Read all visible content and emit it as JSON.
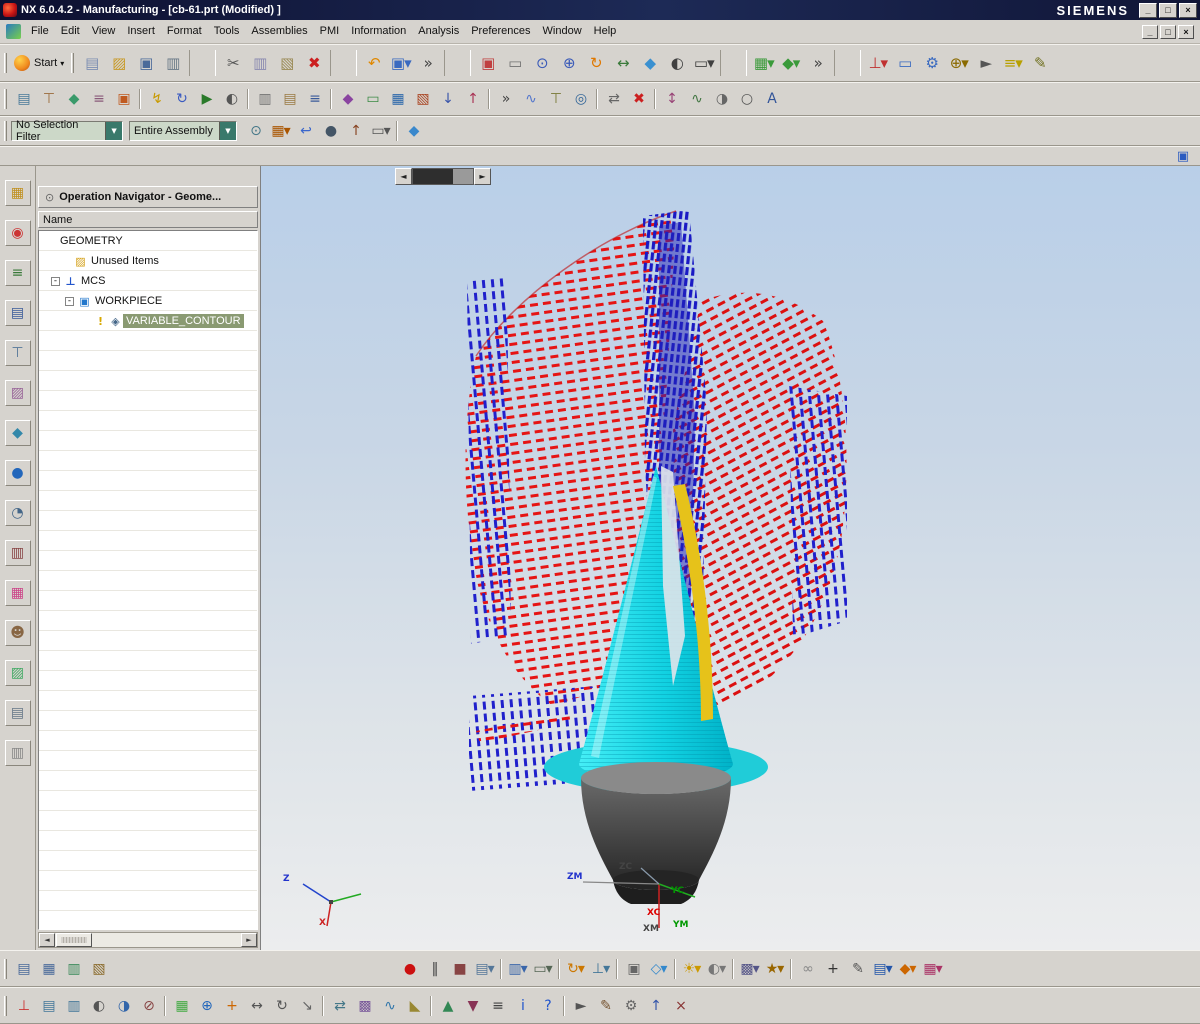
{
  "window": {
    "title": "NX 6.0.4.2 - Manufacturing - [cb-61.prt (Modified) ]",
    "brand": "SIEMENS"
  },
  "glyphs": {
    "minimize": "_",
    "restore": "□",
    "close": "×",
    "scroll_left": "◄",
    "scroll_right": "►",
    "dropdown": "▼",
    "thin_dropdown": "▾",
    "pin": "⊙"
  },
  "menus": [
    "File",
    "Edit",
    "View",
    "Insert",
    "Format",
    "Tools",
    "Assemblies",
    "PMI",
    "Information",
    "Analysis",
    "Preferences",
    "Window",
    "Help"
  ],
  "toolbar_main": {
    "start_label": "Start",
    "items": [
      {
        "n": "new-file-icon",
        "g": "▤",
        "c": "#7d8fb3"
      },
      {
        "n": "open-file-icon",
        "g": "▨",
        "c": "#c89a28"
      },
      {
        "n": "save-icon",
        "g": "▣",
        "c": "#4a6a9a"
      },
      {
        "n": "print-icon",
        "g": "▥",
        "c": "#6a7a88"
      },
      {
        "n": "separator",
        "g": ""
      },
      {
        "n": "cut-icon",
        "g": "✂",
        "c": "#555555"
      },
      {
        "n": "copy-icon",
        "g": "▥",
        "c": "#8a8ab0"
      },
      {
        "n": "paste-icon",
        "g": "▧",
        "c": "#9a8a55"
      },
      {
        "n": "delete-icon",
        "g": "✖",
        "c": "#cc2020"
      },
      {
        "n": "separator",
        "g": ""
      },
      {
        "n": "undo-icon",
        "g": "↶",
        "c": "#e08800"
      },
      {
        "n": "selection-dialog-icon",
        "g": "▣▾",
        "c": "#3a6ac0"
      },
      {
        "n": "overflow-icon",
        "g": "»",
        "c": "#444444"
      },
      {
        "n": "separator",
        "g": ""
      },
      {
        "n": "fit-view-icon",
        "g": "▣",
        "c": "#c04040"
      },
      {
        "n": "zoom-box-icon",
        "g": "▭",
        "c": "#707070"
      },
      {
        "n": "zoom-icon",
        "g": "⊙",
        "c": "#3a5ab8"
      },
      {
        "n": "zoom-in-out-icon",
        "g": "⊕",
        "c": "#3a5ab8"
      },
      {
        "n": "rotate-view-icon",
        "g": "↻",
        "c": "#e07800"
      },
      {
        "n": "pan-icon",
        "g": "↔",
        "c": "#3a7a3a"
      },
      {
        "n": "perspective-icon",
        "g": "◆",
        "c": "#3a90d0"
      },
      {
        "n": "shaded-view-icon",
        "g": "◐",
        "c": "#404040"
      },
      {
        "n": "face-style-icon",
        "g": "▭▾",
        "c": "#404040"
      },
      {
        "n": "separator",
        "g": ""
      },
      {
        "n": "orient-view-icon",
        "g": "▦▾",
        "c": "#3a9a3a"
      },
      {
        "n": "iso-view-icon",
        "g": "◆▾",
        "c": "#3a9a3a"
      },
      {
        "n": "overflow-icon",
        "g": "»",
        "c": "#444444"
      },
      {
        "n": "separator",
        "g": ""
      },
      {
        "n": "csys-icon",
        "g": "⊥▾",
        "c": "#c03030"
      },
      {
        "n": "datum-plane-icon",
        "g": "▭",
        "c": "#3a6ac0"
      },
      {
        "n": "gear-icon",
        "g": "⚙",
        "c": "#3a6ac0"
      },
      {
        "n": "point-icon",
        "g": "⊕▾",
        "c": "#8a6a00"
      },
      {
        "n": "cursor-icon",
        "g": "►",
        "c": "#555555"
      },
      {
        "n": "measure-icon",
        "g": "≡▾",
        "c": "#b8a000"
      },
      {
        "n": "sketch-icon",
        "g": "✎",
        "c": "#707020"
      }
    ]
  },
  "toolbar_mfg": {
    "items": [
      {
        "n": "create-program-icon",
        "g": "▤",
        "c": "#4a7a9a"
      },
      {
        "n": "create-tool-icon",
        "g": "⊤",
        "c": "#9a6a3a"
      },
      {
        "n": "create-geometry-icon",
        "g": "◆",
        "c": "#3a9a6a"
      },
      {
        "n": "create-method-icon",
        "g": "≡",
        "c": "#8a5a7a"
      },
      {
        "n": "create-operation-icon",
        "g": "▣",
        "c": "#c05a20"
      },
      {
        "n": "separator",
        "g": ""
      },
      {
        "n": "generate-toolpath-icon",
        "g": "↯",
        "c": "#c89a00"
      },
      {
        "n": "replay-toolpath-icon",
        "g": "↻",
        "c": "#3a5ac0"
      },
      {
        "n": "verify-toolpath-icon",
        "g": "▶",
        "c": "#2a7a2a"
      },
      {
        "n": "simulate-icon",
        "g": "◐",
        "c": "#555555"
      },
      {
        "n": "separator",
        "g": ""
      },
      {
        "n": "postprocess-icon",
        "g": "▥",
        "c": "#707070"
      },
      {
        "n": "shop-doc-icon",
        "g": "▤",
        "c": "#9a7a44"
      },
      {
        "n": "list-toolpath-icon",
        "g": "≡",
        "c": "#3a5a9a"
      },
      {
        "n": "separator",
        "g": ""
      },
      {
        "n": "machining-environment-icon",
        "g": "◆",
        "c": "#8a44a0"
      },
      {
        "n": "boundary-icon",
        "g": "▭",
        "c": "#3a8a44"
      },
      {
        "n": "mill-area-icon",
        "g": "▦",
        "c": "#2a66aa"
      },
      {
        "n": "drive-method-icon",
        "g": "▧",
        "c": "#aa4422"
      },
      {
        "n": "projection-vector-icon",
        "g": "↓",
        "c": "#3a55aa"
      },
      {
        "n": "tool-axis-icon",
        "g": "↑",
        "c": "#aa3355"
      },
      {
        "n": "separator",
        "g": ""
      },
      {
        "n": "overflow-icon",
        "g": "»",
        "c": "#444444"
      },
      {
        "n": "graph-icon",
        "g": "∿",
        "c": "#5577cc"
      },
      {
        "n": "tool-display-icon",
        "g": "⊤",
        "c": "#777733"
      },
      {
        "n": "feeds-speeds-icon",
        "g": "◎",
        "c": "#336699"
      },
      {
        "n": "separator",
        "g": ""
      },
      {
        "n": "transform-icon",
        "g": "⇄",
        "c": "#666666"
      },
      {
        "n": "delete-operation-icon",
        "g": "✖",
        "c": "#cc2020"
      },
      {
        "n": "separator",
        "g": ""
      },
      {
        "n": "tilt-tool-axis-icon",
        "g": "↕",
        "c": "#994477"
      },
      {
        "n": "smoothing-icon",
        "g": "∿",
        "c": "#447744"
      },
      {
        "n": "balance-icon",
        "g": "◑",
        "c": "#666666"
      },
      {
        "n": "arc-output-icon",
        "g": "○",
        "c": "#555555"
      },
      {
        "n": "annotation-icon",
        "g": "A",
        "c": "#335599"
      }
    ]
  },
  "filterbar": {
    "selection_filter": "No Selection Filter",
    "scope": "Entire Assembly",
    "items": [
      {
        "n": "snap-point-icon",
        "g": "⊙",
        "c": "#447788"
      },
      {
        "n": "selection-grid-icon",
        "g": "▦▾",
        "c": "#aa5500"
      },
      {
        "n": "back-icon",
        "g": "↩",
        "c": "#3a66cc"
      },
      {
        "n": "sphere-display-icon",
        "g": "●",
        "c": "#445566"
      },
      {
        "n": "elevate-icon",
        "g": "↑",
        "c": "#884422"
      },
      {
        "n": "marquee-select-icon",
        "g": "▭▾",
        "c": "#555555"
      },
      {
        "n": "separator",
        "g": ""
      },
      {
        "n": "assembly-cube-icon",
        "g": "◆",
        "c": "#3a88cc"
      }
    ]
  },
  "resource_bar": {
    "items": [
      {
        "n": "assembly-navigator-icon",
        "g": "▦",
        "c": "#c09020"
      },
      {
        "n": "constraint-navigator-icon",
        "g": "◉",
        "c": "#cc3333"
      },
      {
        "n": "part-navigator-icon",
        "g": "≡",
        "c": "#3a7a3a"
      },
      {
        "n": "operation-navigator-icon",
        "g": "▤",
        "c": "#3a5a9a"
      },
      {
        "n": "machine-tool-navigator-icon",
        "g": "⊤",
        "c": "#557799"
      },
      {
        "n": "reuse-library-icon",
        "g": "▨",
        "c": "#996699"
      },
      {
        "n": "hd3d-tools-icon",
        "g": "◆",
        "c": "#3388aa"
      },
      {
        "n": "web-browser-icon",
        "g": "●",
        "c": "#2266bb"
      },
      {
        "n": "history-icon",
        "g": "◔",
        "c": "#446688"
      },
      {
        "n": "process-studio-icon",
        "g": "▥",
        "c": "#884444"
      },
      {
        "n": "manufacturing-wizards-icon",
        "g": "▦",
        "c": "#cc4488"
      },
      {
        "n": "roles-icon",
        "g": "☻",
        "c": "#886644"
      },
      {
        "n": "system-scenes-icon",
        "g": "▨",
        "c": "#44aa66"
      },
      {
        "n": "documents-icon",
        "g": "▤",
        "c": "#667788"
      },
      {
        "n": "notes-icon",
        "g": "▥",
        "c": "#888888"
      }
    ]
  },
  "navigator": {
    "title": "Operation Navigator - Geome...",
    "column_header": "Name",
    "rows": [
      {
        "pad": "6px",
        "ex": "",
        "i1": "",
        "i1c": "",
        "i2": "",
        "i2c": "",
        "label": "GEOMETRY",
        "bg": "",
        "fg": ""
      },
      {
        "pad": "22px",
        "ex": "",
        "i1": "▨",
        "i1c": "#d4a017",
        "i2": "",
        "i2c": "",
        "label": "Unused Items",
        "bg": "",
        "fg": ""
      },
      {
        "pad": "12px",
        "ex": "-",
        "i1": "⊥",
        "i1c": "#2255cc",
        "i2": "",
        "i2c": "",
        "label": "MCS",
        "bg": "",
        "fg": ""
      },
      {
        "pad": "26px",
        "ex": "-",
        "i1": "▣",
        "i1c": "#2277cc",
        "i2": "",
        "i2c": "",
        "label": "WORKPIECE",
        "bg": "",
        "fg": ""
      },
      {
        "pad": "42px",
        "ex": "",
        "i1": "!",
        "i1c": "#d8a800",
        "i2": "◈",
        "i2c": "#446688",
        "label": "VARIABLE_CONTOUR",
        "bg": "#8a9a72",
        "fg": "#ffffff"
      }
    ]
  },
  "viewport": {
    "triad": {
      "z": "Z",
      "x": "X"
    },
    "mcs_labels": {
      "zm": "ZM",
      "zc": "ZC",
      "yc": "YC",
      "xc": "XC",
      "xm": "XM",
      "ym": "YM"
    }
  },
  "bottom1": {
    "items": [
      {
        "n": "view-tool-1-icon",
        "g": "▤",
        "c": "#4a6a9a"
      },
      {
        "n": "view-tool-2-icon",
        "g": "▦",
        "c": "#4a6a9a"
      },
      {
        "n": "view-tool-3-icon",
        "g": "▥",
        "c": "#3a8a5a"
      },
      {
        "n": "view-tool-4-icon",
        "g": "▧",
        "c": "#8a6a2a"
      },
      {
        "n": "gap",
        "g": ""
      },
      {
        "n": "record-movie-icon",
        "g": "●",
        "c": "#cc1010"
      },
      {
        "n": "pause-icon",
        "g": "‖",
        "c": "#444444"
      },
      {
        "n": "stop-icon",
        "g": "■",
        "c": "#884444"
      },
      {
        "n": "export-image-icon",
        "g": "▤▾",
        "c": "#557799"
      },
      {
        "n": "separator",
        "g": ""
      },
      {
        "n": "section-view-icon",
        "g": "▥▾",
        "c": "#3a66aa"
      },
      {
        "n": "clip-plane-icon",
        "g": "▭▾",
        "c": "#556655"
      },
      {
        "n": "separator",
        "g": ""
      },
      {
        "n": "dynamic-rotate-icon",
        "g": "↻▾",
        "c": "#cc7700"
      },
      {
        "n": "orient-wcs-icon",
        "g": "⊥▾",
        "c": "#447799"
      },
      {
        "n": "separator",
        "g": ""
      },
      {
        "n": "snapshot-icon",
        "g": "▣",
        "c": "#666666"
      },
      {
        "n": "perspective-toggle-icon",
        "g": "◇▾",
        "c": "#3388cc"
      },
      {
        "n": "separator",
        "g": ""
      },
      {
        "n": "lighting-icon",
        "g": "☀▾",
        "c": "#cc9900"
      },
      {
        "n": "material-icon",
        "g": "◐▾",
        "c": "#777777"
      },
      {
        "n": "separator",
        "g": ""
      },
      {
        "n": "background-icon",
        "g": "▩▾",
        "c": "#555588"
      },
      {
        "n": "effects-icon",
        "g": "★▾",
        "c": "#996600"
      },
      {
        "n": "separator",
        "g": ""
      },
      {
        "n": "link-icon",
        "g": "∞",
        "c": "#888888"
      },
      {
        "n": "add-icon",
        "g": "+",
        "c": "#333333"
      },
      {
        "n": "annotate-icon",
        "g": "✎",
        "c": "#555555"
      },
      {
        "n": "stack-icon",
        "g": "▤▾",
        "c": "#2255aa"
      },
      {
        "n": "box3d-icon",
        "g": "◆▾",
        "c": "#cc6600"
      },
      {
        "n": "palette-icon",
        "g": "▦▾",
        "c": "#aa3366"
      }
    ]
  },
  "bottom2": {
    "items": [
      {
        "n": "wcs-display-icon",
        "g": "⊥",
        "c": "#cc3333"
      },
      {
        "n": "layer-settings-icon",
        "g": "▤",
        "c": "#447799"
      },
      {
        "n": "layer-visible-icon",
        "g": "▥",
        "c": "#447799"
      },
      {
        "n": "object-display-icon",
        "g": "◐",
        "c": "#555555"
      },
      {
        "n": "show-hide-icon",
        "g": "◑",
        "c": "#3366aa"
      },
      {
        "n": "immediate-hide-icon",
        "g": "⊘",
        "c": "#884444"
      },
      {
        "n": "separator",
        "g": ""
      },
      {
        "n": "grid-icon",
        "g": "▦",
        "c": "#44aa44"
      },
      {
        "n": "point-constructor-icon",
        "g": "⊕",
        "c": "#2266bb"
      },
      {
        "n": "plus-icon",
        "g": "+",
        "c": "#cc6600"
      },
      {
        "n": "move-object-icon",
        "g": "↔",
        "c": "#555555"
      },
      {
        "n": "rotate-object-icon",
        "g": "↻",
        "c": "#555555"
      },
      {
        "n": "drag-icon",
        "g": "↘",
        "c": "#666666"
      },
      {
        "n": "separator",
        "g": ""
      },
      {
        "n": "mirror-icon",
        "g": "⇄",
        "c": "#447788"
      },
      {
        "n": "pattern-icon",
        "g": "▩",
        "c": "#775599"
      },
      {
        "n": "blend-icon",
        "g": "∿",
        "c": "#3377aa"
      },
      {
        "n": "chamfer-icon",
        "g": "◣",
        "c": "#998833"
      },
      {
        "n": "separator",
        "g": ""
      },
      {
        "n": "max-icon",
        "g": "▲",
        "c": "#338855"
      },
      {
        "n": "min-icon",
        "g": "▼",
        "c": "#883355"
      },
      {
        "n": "list-icon",
        "g": "≡",
        "c": "#444444"
      },
      {
        "n": "info-icon",
        "g": "i",
        "c": "#2255cc"
      },
      {
        "n": "help-icon",
        "g": "?",
        "c": "#2255cc"
      },
      {
        "n": "separator",
        "g": ""
      },
      {
        "n": "play-macro-icon",
        "g": "►",
        "c": "#555555"
      },
      {
        "n": "journal-icon",
        "g": "✎",
        "c": "#775533"
      },
      {
        "n": "customize-icon",
        "g": "⚙",
        "c": "#666666"
      },
      {
        "n": "arrow-up-icon",
        "g": "↑",
        "c": "#3355aa"
      },
      {
        "n": "close-toolbar-icon",
        "g": "×",
        "c": "#883333"
      }
    ]
  }
}
